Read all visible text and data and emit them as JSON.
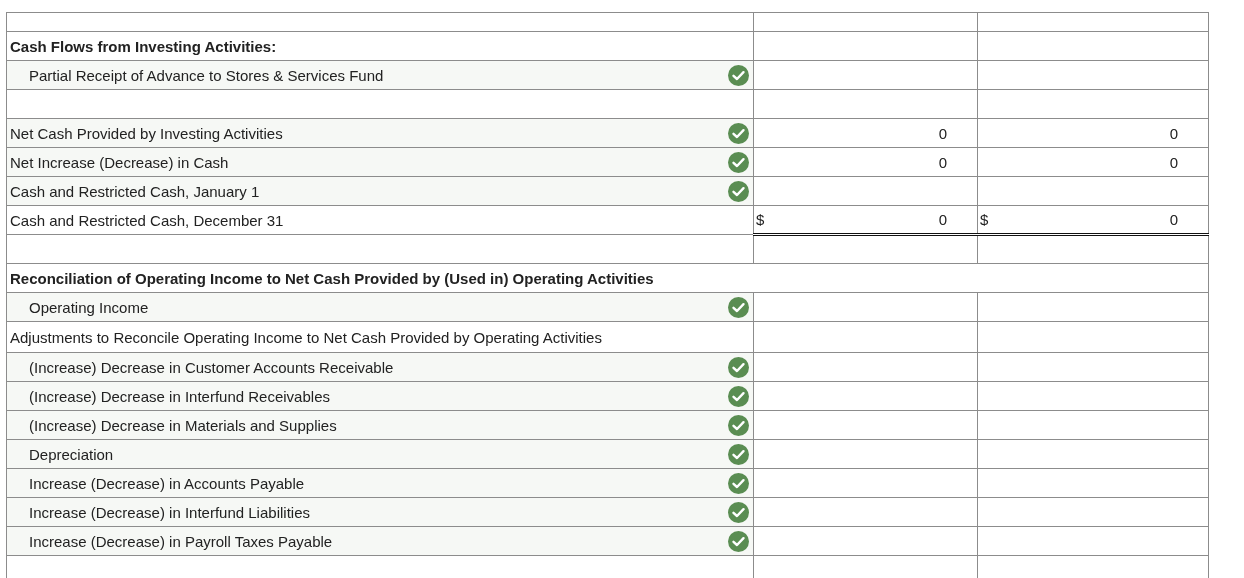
{
  "rows": [
    {
      "kind": "blank"
    },
    {
      "kind": "heading",
      "label": "Cash Flows from Investing Activities:"
    },
    {
      "kind": "line",
      "label": "Partial Receipt of Advance to Stores & Services Fund",
      "indent": true,
      "checked": true
    },
    {
      "kind": "blank"
    },
    {
      "kind": "line",
      "label": "Net Cash Provided by Investing Activities",
      "indent": false,
      "checked": true,
      "top_rule": true,
      "column_2": {
        "amount": "0"
      },
      "column_3": {
        "amount": "0"
      }
    },
    {
      "kind": "line",
      "label": "Net Increase (Decrease) in Cash",
      "indent": false,
      "checked": true,
      "top_rule": true,
      "column_2": {
        "amount": "0"
      },
      "column_3": {
        "amount": "0"
      }
    },
    {
      "kind": "line",
      "label": "Cash and Restricted Cash, January 1",
      "indent": false,
      "checked": true
    },
    {
      "kind": "line",
      "label": "Cash and Restricted Cash, December 31",
      "indent": false,
      "checked": false,
      "top_rule": true,
      "double_underline": true,
      "column_2": {
        "currency": "$",
        "amount": "0"
      },
      "column_3": {
        "currency": "$",
        "amount": "0"
      }
    },
    {
      "kind": "blank"
    },
    {
      "kind": "wide_heading",
      "label": "Reconciliation of Operating Income to Net Cash Provided by (Used in) Operating Activities"
    },
    {
      "kind": "line",
      "label": "Operating Income",
      "indent": true,
      "checked": true
    },
    {
      "kind": "line",
      "label": "Adjustments to Reconcile Operating Income to Net Cash Provided by Operating Activities",
      "indent": false,
      "checked": false
    },
    {
      "kind": "line",
      "label": "(Increase) Decrease in Customer Accounts Receivable",
      "indent": true,
      "checked": true
    },
    {
      "kind": "line",
      "label": "(Increase) Decrease in Interfund Receivables",
      "indent": true,
      "checked": true
    },
    {
      "kind": "line",
      "label": "(Increase) Decrease in Materials and Supplies",
      "indent": true,
      "checked": true
    },
    {
      "kind": "line",
      "label": "Depreciation",
      "indent": true,
      "checked": true
    },
    {
      "kind": "line",
      "label": "Increase (Decrease) in Accounts Payable",
      "indent": true,
      "checked": true
    },
    {
      "kind": "line",
      "label": "Increase (Decrease) in Interfund Liabilities",
      "indent": true,
      "checked": true
    },
    {
      "kind": "line",
      "label": "Increase (Decrease) in Payroll Taxes Payable",
      "indent": true,
      "checked": true
    },
    {
      "kind": "blank"
    }
  ]
}
